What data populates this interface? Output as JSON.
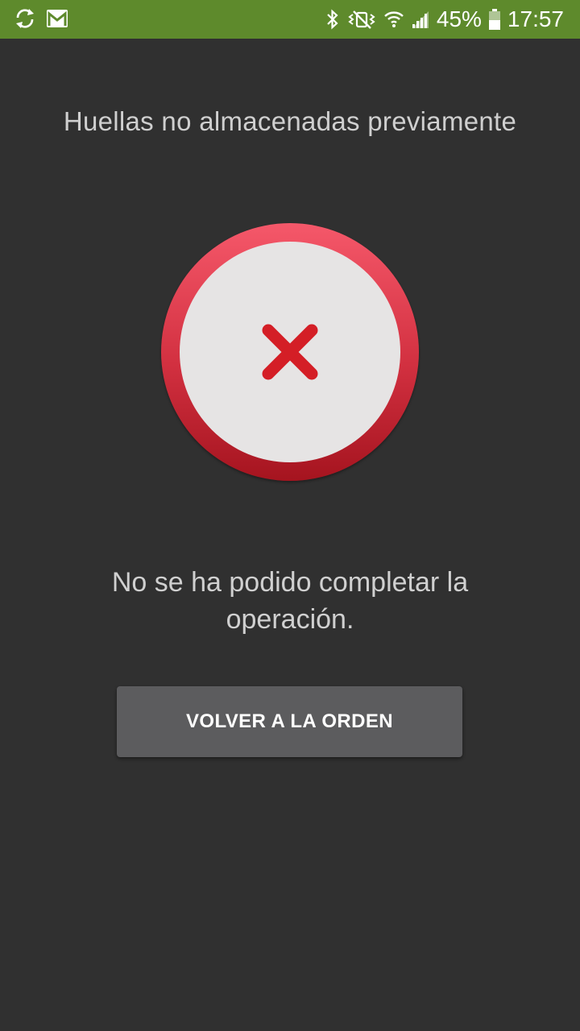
{
  "status_bar": {
    "background": "#5e8a2c",
    "left_icons": [
      "sync-icon",
      "gmail-icon"
    ],
    "right_icons": [
      "bluetooth-icon",
      "vibrate-icon",
      "wifi-icon",
      "signal-icon",
      "battery-icon"
    ],
    "battery_percent": "45%",
    "time": "17:57"
  },
  "screen": {
    "title": "Huellas no almacenadas previamente",
    "status_icon": "error-x-icon",
    "message": "No se ha podido completar la operación.",
    "button_label": "VOLVER A LA ORDEN"
  },
  "colors": {
    "background": "#303030",
    "error_ring": "#d23040",
    "error_mark": "#d41e26",
    "button": "#5c5c5e"
  }
}
